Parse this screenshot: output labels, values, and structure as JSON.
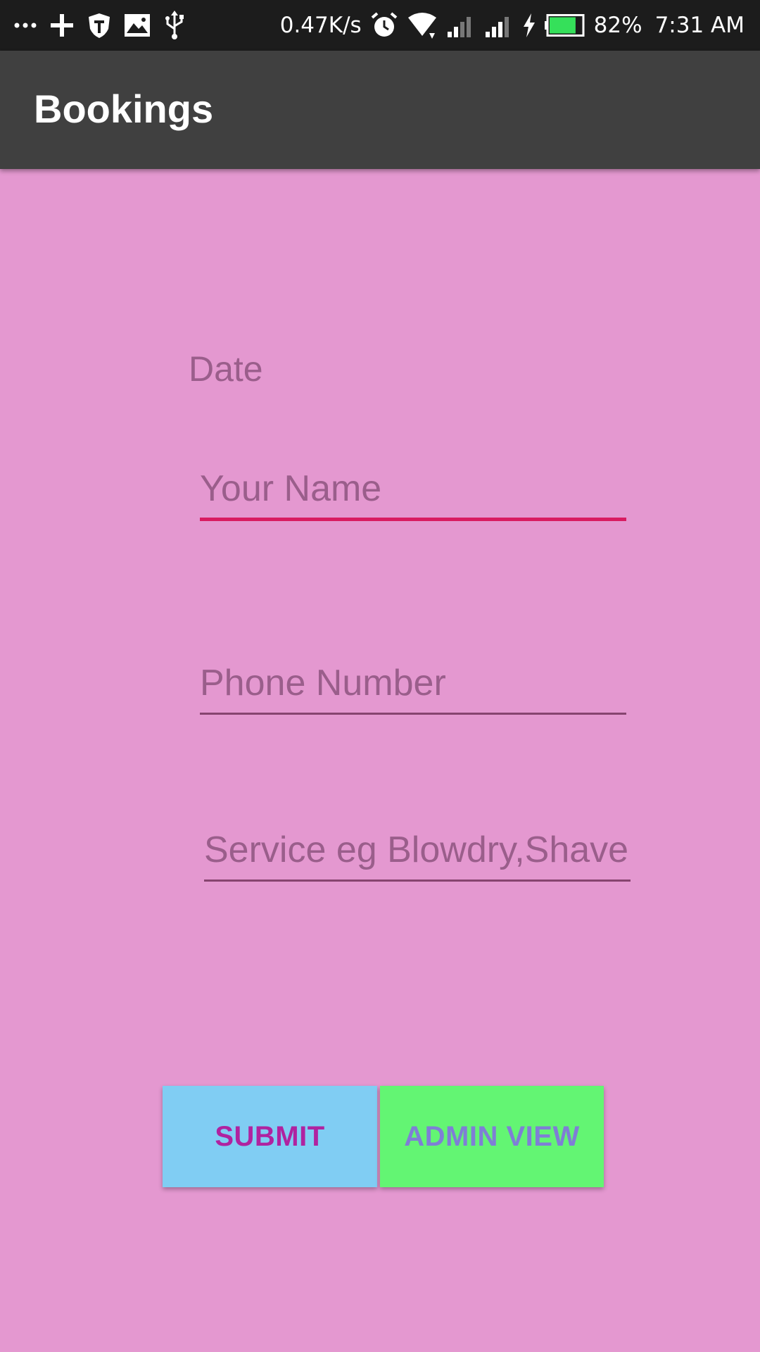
{
  "status_bar": {
    "net_speed": "0.47K/s",
    "battery_percent": "82%",
    "time": "7:31 AM",
    "battery_level": 0.82,
    "left_icons": [
      "more-icon",
      "plus-icon",
      "shield-icon",
      "image-icon",
      "usb-icon"
    ],
    "right_icons": [
      "alarm-icon",
      "wifi-icon",
      "signal-icon",
      "signal-icon",
      "charging-icon",
      "battery-icon"
    ]
  },
  "app_bar": {
    "title": "Bookings"
  },
  "form": {
    "date_label": "Date",
    "name_placeholder": "Your Name",
    "phone_placeholder": "Phone Number",
    "service_placeholder": "Service eg Blowdry,Shave"
  },
  "buttons": {
    "submit_label": "SUBMIT",
    "admin_label": "ADMIN VIEW"
  },
  "colors": {
    "background": "#e498d0",
    "app_bar": "#404040",
    "status_bar": "#1c1c1c",
    "accent_underline": "#d81b60",
    "submit_bg": "#80cdf3",
    "submit_text": "#b022a0",
    "admin_bg": "#63f573",
    "admin_text": "#7f7ed6"
  }
}
